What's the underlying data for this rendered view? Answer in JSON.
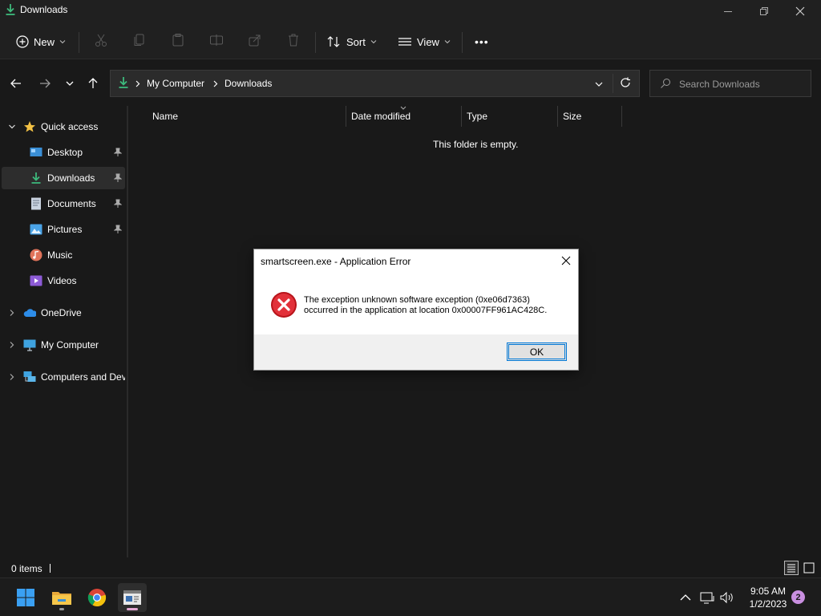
{
  "window": {
    "title": "Downloads",
    "icon": "download-icon"
  },
  "toolbar": {
    "new_label": "New",
    "sort_label": "Sort",
    "view_label": "View",
    "more_label": "•••"
  },
  "address": {
    "crumbs": [
      "My Computer",
      "Downloads"
    ],
    "search_placeholder": "Search Downloads"
  },
  "sidebar": {
    "items": [
      {
        "label": "Quick access",
        "icon": "star-icon"
      },
      {
        "label": "Desktop",
        "icon": "desktop-icon",
        "pinned": true
      },
      {
        "label": "Downloads",
        "icon": "download-icon",
        "pinned": true,
        "selected": true
      },
      {
        "label": "Documents",
        "icon": "document-icon",
        "pinned": true
      },
      {
        "label": "Pictures",
        "icon": "pictures-icon",
        "pinned": true
      },
      {
        "label": "Music",
        "icon": "music-icon"
      },
      {
        "label": "Videos",
        "icon": "videos-icon"
      },
      {
        "label": "OneDrive",
        "icon": "cloud-icon"
      },
      {
        "label": "My Computer",
        "icon": "monitor-icon"
      },
      {
        "label": "Computers and Dev",
        "icon": "network-icon"
      }
    ]
  },
  "columns": [
    "Name",
    "Date modified",
    "Type",
    "Size"
  ],
  "content": {
    "empty_message": "This folder is empty."
  },
  "status": {
    "item_count": "0 items"
  },
  "dialog": {
    "title": "smartscreen.exe - Application Error",
    "message_line1": "The exception unknown software exception (0xe06d7363)",
    "message_line2": "occurred in the application at location 0x00007FF961AC428C.",
    "ok_label": "OK"
  },
  "taskbar": {
    "time": "9:05 AM",
    "date": "1/2/2023",
    "notification_count": "2"
  },
  "colors": {
    "accent_green": "#3dba7c",
    "error_red": "#d9262c",
    "folder_yellow": "#f2c144",
    "notif_purple": "#c98fe0"
  }
}
